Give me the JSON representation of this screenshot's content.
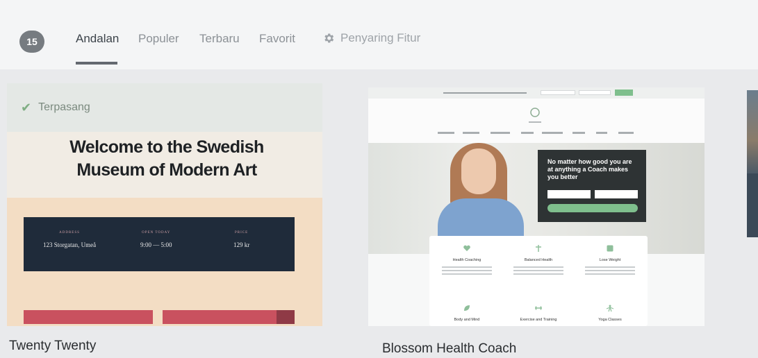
{
  "filter_bar": {
    "count": "15",
    "tabs": [
      {
        "label": "Andalan",
        "active": true
      },
      {
        "label": "Populer",
        "active": false
      },
      {
        "label": "Terbaru",
        "active": false
      },
      {
        "label": "Favorit",
        "active": false
      }
    ],
    "feature_filter": {
      "label": "Penyaring Fitur",
      "icon": "gear-icon"
    }
  },
  "themes": [
    {
      "name": "Twenty Twenty",
      "installed_label": "Terpasang",
      "preview": {
        "heading": "Welcome to the Swedish Museum of Modern Art",
        "info": [
          {
            "label": "ADDRESS",
            "value": "123 Storgatan, Umeå"
          },
          {
            "label": "OPEN TODAY",
            "value": "9:00 — 5:00"
          },
          {
            "label": "PRICE",
            "value": "129 kr"
          }
        ]
      }
    },
    {
      "name": "Blossom Health Coach",
      "preview": {
        "overlay_text": "No matter how good you are at anything a Coach makes you better",
        "features": [
          "Health Coaching",
          "Balanced Health",
          "Lose Weight",
          "Body and Mind",
          "Exercise and Training",
          "Yoga Classes"
        ]
      }
    }
  ],
  "colors": {
    "badge": "#767b80",
    "installed_check": "#7fae83",
    "accent_red": "#c9515f",
    "accent_green": "#7fbf8d",
    "info_navy": "#1f2b3a"
  }
}
